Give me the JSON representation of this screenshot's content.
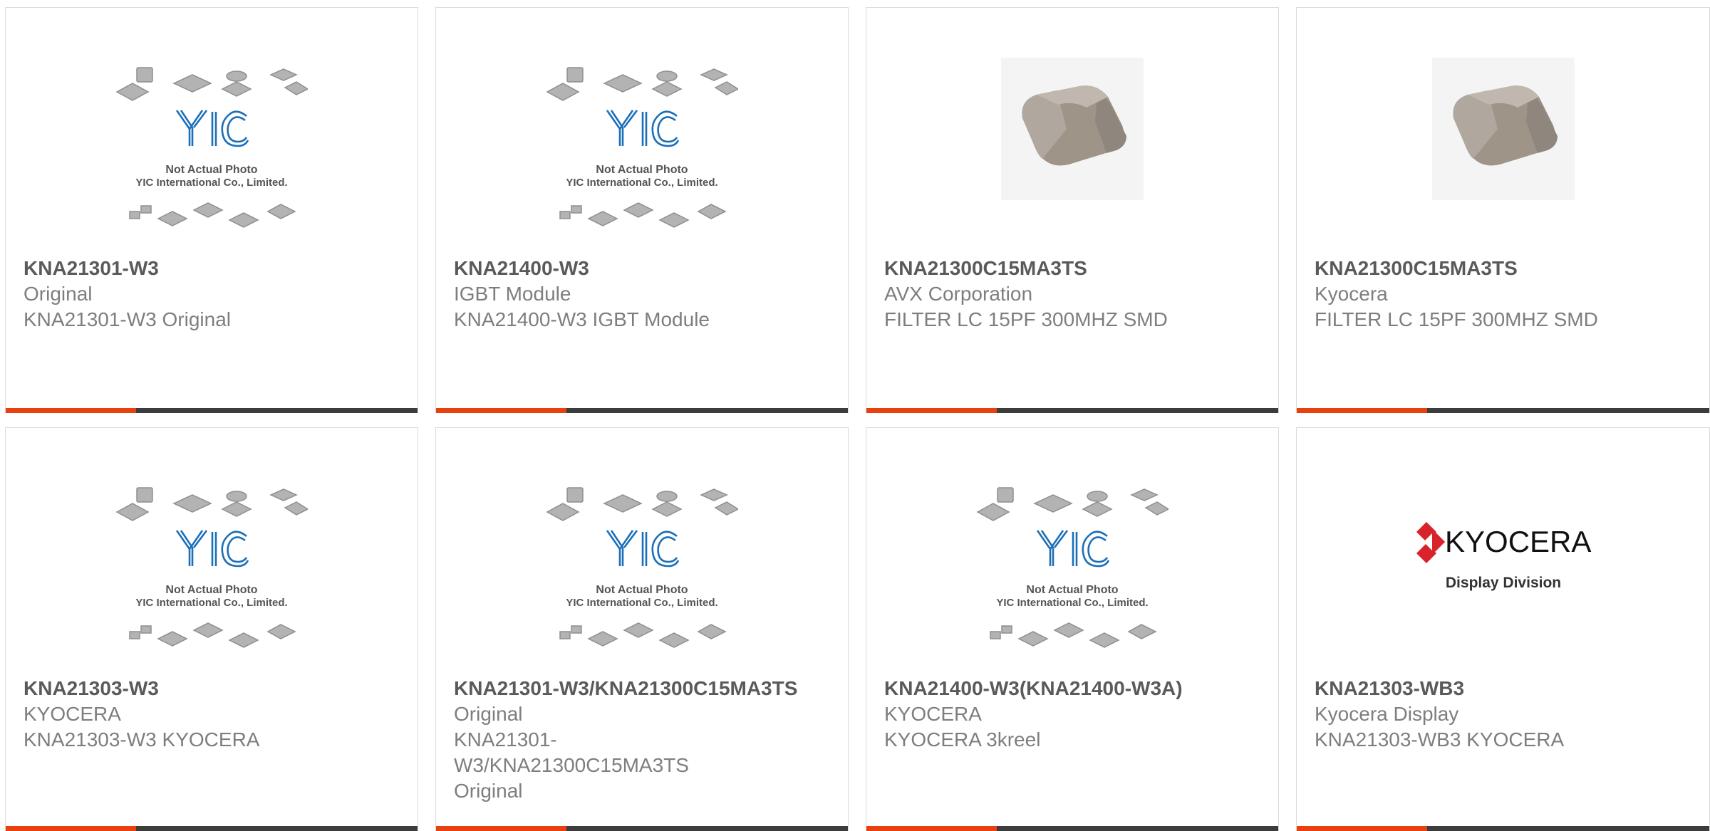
{
  "placeholder": {
    "line1": "Not Actual Photo",
    "line2": "YIC International Co., Limited.",
    "logo": "YIC"
  },
  "kyocera": {
    "brand": "KYOCERA",
    "division": "Display Division"
  },
  "colors": {
    "accent": "#e8410f",
    "bar": "#3c3c3c",
    "kyocera_red": "#d8232a",
    "yic_blue": "#1b6fb8"
  },
  "products": [
    {
      "part": "KNA21301-W3",
      "maker": "Original",
      "desc": "KNA21301-W3 Original",
      "image": "yic-placeholder-icon"
    },
    {
      "part": "KNA21400-W3",
      "maker": "IGBT Module",
      "desc": "KNA21400-W3 IGBT Module",
      "image": "yic-placeholder-icon"
    },
    {
      "part": "KNA21300C15MA3TS",
      "maker": "AVX Corporation",
      "desc": "FILTER LC 15PF 300MHZ SMD",
      "image": "chip-component-photo"
    },
    {
      "part": "KNA21300C15MA3TS",
      "maker": "Kyocera",
      "desc": "FILTER LC 15PF 300MHZ SMD",
      "image": "chip-component-photo"
    },
    {
      "part": "KNA21303-W3",
      "maker": "KYOCERA",
      "desc": "KNA21303-W3 KYOCERA",
      "image": "yic-placeholder-icon"
    },
    {
      "part": "KNA21301-W3/KNA21300C15MA3TS",
      "maker": "Original",
      "desc": "KNA21301-W3/KNA21300C15MA3TS Original",
      "image": "yic-placeholder-icon"
    },
    {
      "part": "KNA21400-W3(KNA21400-W3A)",
      "maker": "KYOCERA",
      "desc": "KYOCERA 3kreel",
      "image": "yic-placeholder-icon"
    },
    {
      "part": "KNA21303-WB3",
      "maker": "Kyocera Display",
      "desc": "KNA21303-WB3 KYOCERA",
      "image": "kyocera-display-logo"
    }
  ]
}
